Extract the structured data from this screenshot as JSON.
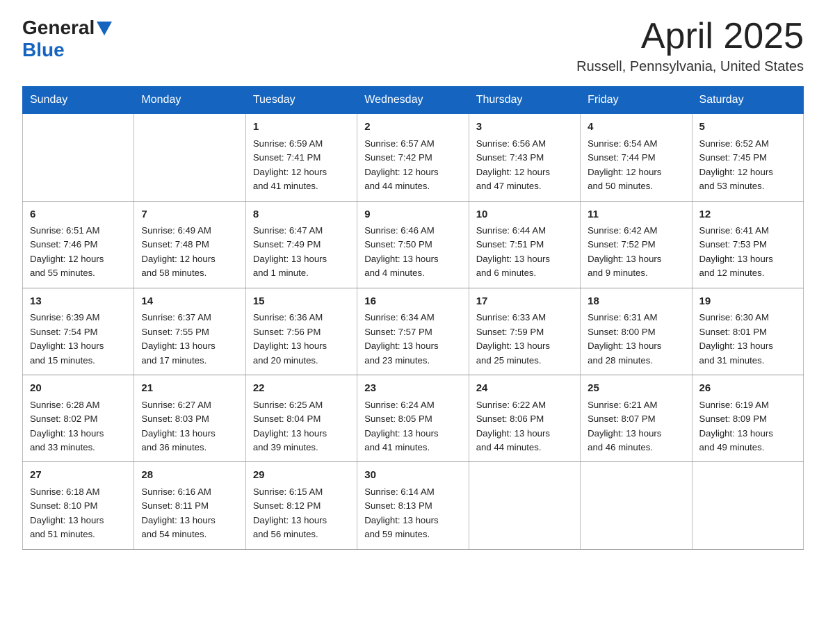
{
  "header": {
    "logo_general": "General",
    "logo_blue": "Blue",
    "month_title": "April 2025",
    "subtitle": "Russell, Pennsylvania, United States"
  },
  "weekdays": [
    "Sunday",
    "Monday",
    "Tuesday",
    "Wednesday",
    "Thursday",
    "Friday",
    "Saturday"
  ],
  "weeks": [
    [
      {
        "num": "",
        "info": ""
      },
      {
        "num": "",
        "info": ""
      },
      {
        "num": "1",
        "info": "Sunrise: 6:59 AM\nSunset: 7:41 PM\nDaylight: 12 hours\nand 41 minutes."
      },
      {
        "num": "2",
        "info": "Sunrise: 6:57 AM\nSunset: 7:42 PM\nDaylight: 12 hours\nand 44 minutes."
      },
      {
        "num": "3",
        "info": "Sunrise: 6:56 AM\nSunset: 7:43 PM\nDaylight: 12 hours\nand 47 minutes."
      },
      {
        "num": "4",
        "info": "Sunrise: 6:54 AM\nSunset: 7:44 PM\nDaylight: 12 hours\nand 50 minutes."
      },
      {
        "num": "5",
        "info": "Sunrise: 6:52 AM\nSunset: 7:45 PM\nDaylight: 12 hours\nand 53 minutes."
      }
    ],
    [
      {
        "num": "6",
        "info": "Sunrise: 6:51 AM\nSunset: 7:46 PM\nDaylight: 12 hours\nand 55 minutes."
      },
      {
        "num": "7",
        "info": "Sunrise: 6:49 AM\nSunset: 7:48 PM\nDaylight: 12 hours\nand 58 minutes."
      },
      {
        "num": "8",
        "info": "Sunrise: 6:47 AM\nSunset: 7:49 PM\nDaylight: 13 hours\nand 1 minute."
      },
      {
        "num": "9",
        "info": "Sunrise: 6:46 AM\nSunset: 7:50 PM\nDaylight: 13 hours\nand 4 minutes."
      },
      {
        "num": "10",
        "info": "Sunrise: 6:44 AM\nSunset: 7:51 PM\nDaylight: 13 hours\nand 6 minutes."
      },
      {
        "num": "11",
        "info": "Sunrise: 6:42 AM\nSunset: 7:52 PM\nDaylight: 13 hours\nand 9 minutes."
      },
      {
        "num": "12",
        "info": "Sunrise: 6:41 AM\nSunset: 7:53 PM\nDaylight: 13 hours\nand 12 minutes."
      }
    ],
    [
      {
        "num": "13",
        "info": "Sunrise: 6:39 AM\nSunset: 7:54 PM\nDaylight: 13 hours\nand 15 minutes."
      },
      {
        "num": "14",
        "info": "Sunrise: 6:37 AM\nSunset: 7:55 PM\nDaylight: 13 hours\nand 17 minutes."
      },
      {
        "num": "15",
        "info": "Sunrise: 6:36 AM\nSunset: 7:56 PM\nDaylight: 13 hours\nand 20 minutes."
      },
      {
        "num": "16",
        "info": "Sunrise: 6:34 AM\nSunset: 7:57 PM\nDaylight: 13 hours\nand 23 minutes."
      },
      {
        "num": "17",
        "info": "Sunrise: 6:33 AM\nSunset: 7:59 PM\nDaylight: 13 hours\nand 25 minutes."
      },
      {
        "num": "18",
        "info": "Sunrise: 6:31 AM\nSunset: 8:00 PM\nDaylight: 13 hours\nand 28 minutes."
      },
      {
        "num": "19",
        "info": "Sunrise: 6:30 AM\nSunset: 8:01 PM\nDaylight: 13 hours\nand 31 minutes."
      }
    ],
    [
      {
        "num": "20",
        "info": "Sunrise: 6:28 AM\nSunset: 8:02 PM\nDaylight: 13 hours\nand 33 minutes."
      },
      {
        "num": "21",
        "info": "Sunrise: 6:27 AM\nSunset: 8:03 PM\nDaylight: 13 hours\nand 36 minutes."
      },
      {
        "num": "22",
        "info": "Sunrise: 6:25 AM\nSunset: 8:04 PM\nDaylight: 13 hours\nand 39 minutes."
      },
      {
        "num": "23",
        "info": "Sunrise: 6:24 AM\nSunset: 8:05 PM\nDaylight: 13 hours\nand 41 minutes."
      },
      {
        "num": "24",
        "info": "Sunrise: 6:22 AM\nSunset: 8:06 PM\nDaylight: 13 hours\nand 44 minutes."
      },
      {
        "num": "25",
        "info": "Sunrise: 6:21 AM\nSunset: 8:07 PM\nDaylight: 13 hours\nand 46 minutes."
      },
      {
        "num": "26",
        "info": "Sunrise: 6:19 AM\nSunset: 8:09 PM\nDaylight: 13 hours\nand 49 minutes."
      }
    ],
    [
      {
        "num": "27",
        "info": "Sunrise: 6:18 AM\nSunset: 8:10 PM\nDaylight: 13 hours\nand 51 minutes."
      },
      {
        "num": "28",
        "info": "Sunrise: 6:16 AM\nSunset: 8:11 PM\nDaylight: 13 hours\nand 54 minutes."
      },
      {
        "num": "29",
        "info": "Sunrise: 6:15 AM\nSunset: 8:12 PM\nDaylight: 13 hours\nand 56 minutes."
      },
      {
        "num": "30",
        "info": "Sunrise: 6:14 AM\nSunset: 8:13 PM\nDaylight: 13 hours\nand 59 minutes."
      },
      {
        "num": "",
        "info": ""
      },
      {
        "num": "",
        "info": ""
      },
      {
        "num": "",
        "info": ""
      }
    ]
  ]
}
